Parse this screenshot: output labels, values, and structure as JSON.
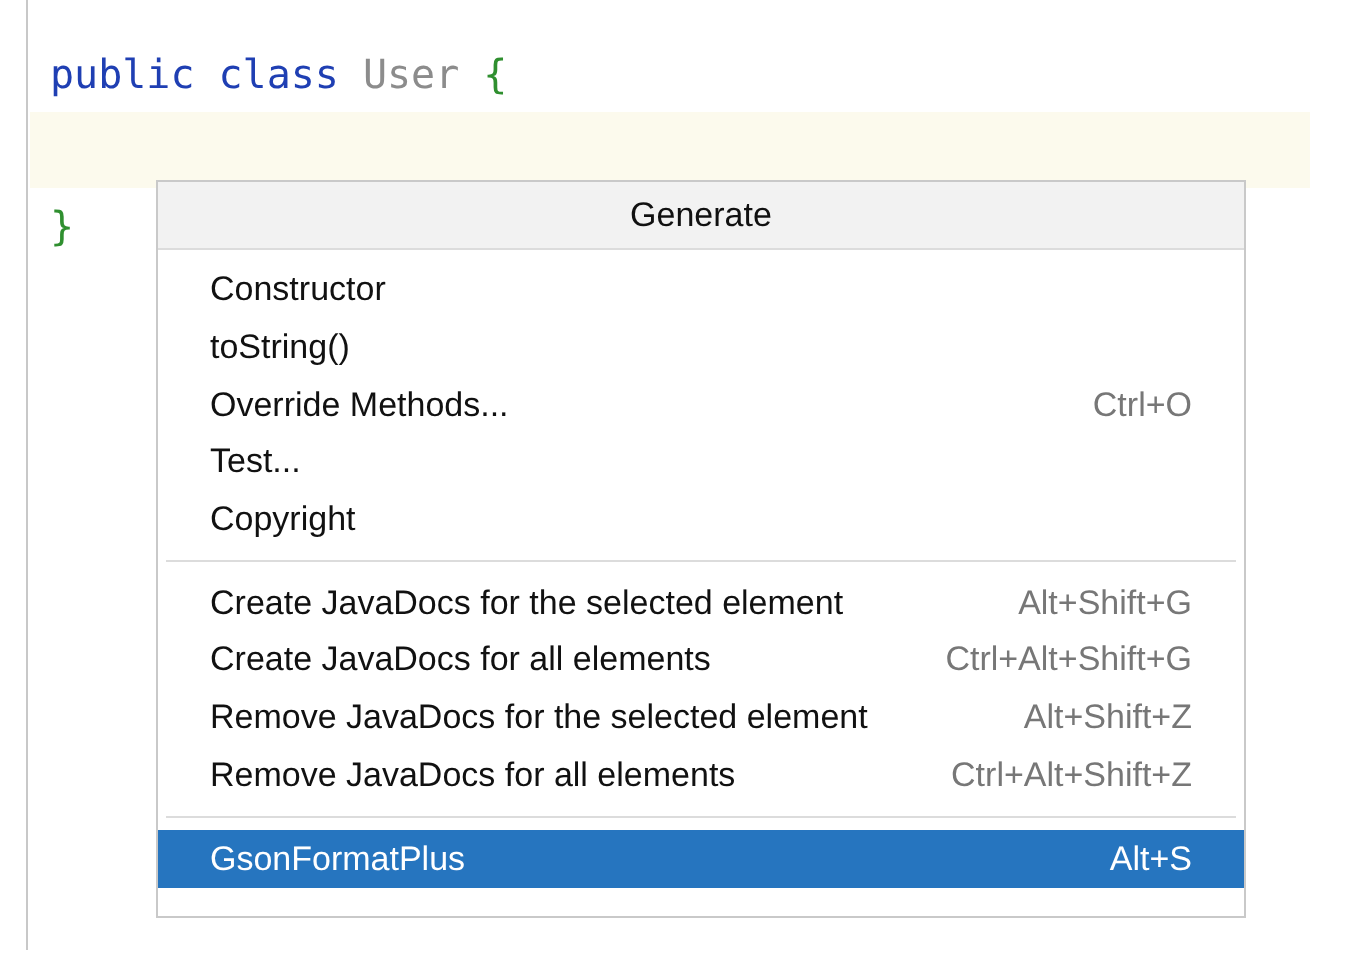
{
  "editor": {
    "lines": [
      {
        "current": false,
        "tokens": [
          {
            "kind": "keyword",
            "text": "public"
          },
          {
            "kind": "keyword",
            "text": "class"
          },
          {
            "kind": "unused",
            "text": "User"
          },
          {
            "kind": "brace",
            "text": "{"
          }
        ]
      },
      {
        "current": true
      },
      {
        "current": false,
        "tokens": [
          {
            "kind": "brace",
            "text": "}"
          }
        ]
      }
    ]
  },
  "popup": {
    "title": "Generate",
    "groups": [
      [
        {
          "label": "Constructor",
          "selected": false
        },
        {
          "label": "toString()",
          "selected": false
        },
        {
          "label": "Override Methods...",
          "shortcut": "Ctrl+O",
          "selected": false
        },
        {
          "label": "Test...",
          "selected": false
        },
        {
          "label": "Copyright",
          "selected": false
        }
      ],
      [
        {
          "label": "Create JavaDocs for the selected element",
          "shortcut": "Alt+Shift+G",
          "selected": false
        },
        {
          "label": "Create JavaDocs for all elements",
          "shortcut": "Ctrl+Alt+Shift+G",
          "selected": false
        },
        {
          "label": "Remove JavaDocs for the selected element",
          "shortcut": "Alt+Shift+Z",
          "selected": false
        },
        {
          "label": "Remove JavaDocs for all elements",
          "shortcut": "Ctrl+Alt+Shift+Z",
          "selected": false
        }
      ],
      [
        {
          "label": "GsonFormatPlus",
          "shortcut": "Alt+S",
          "selected": true
        }
      ]
    ]
  }
}
